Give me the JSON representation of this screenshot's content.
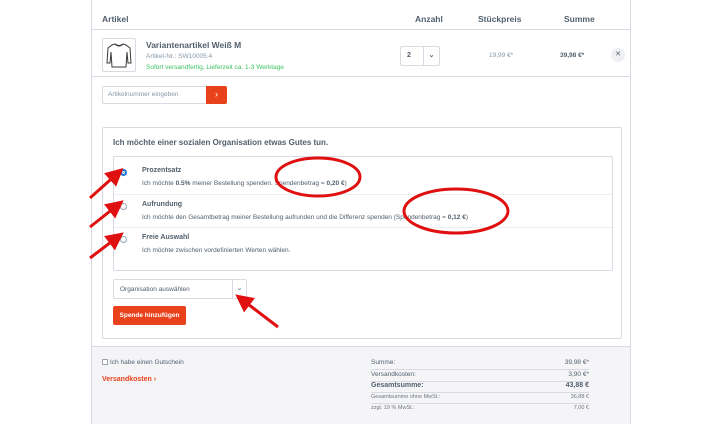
{
  "cart_header": {
    "article": "Artikel",
    "quantity": "Anzahl",
    "unit_price": "Stückpreis",
    "total": "Summe"
  },
  "item": {
    "name": "Variantenartikel Weiß M",
    "sku": "Artikel-Nr.: SW10005.4",
    "shipping": "Sofort versandfertig, Lieferzeit ca. 1-3 Werktage",
    "quantity": "2",
    "unit_price": "19,99 €*",
    "total": "39,98 €*",
    "remove_icon": "✕"
  },
  "article_input": {
    "placeholder": "Artikelnummer eingeben",
    "button": "›"
  },
  "donation": {
    "title": "Ich möchte einer sozialen Organisation etwas Gutes tun.",
    "options": [
      {
        "title": "Prozentsatz",
        "desc_pre": "Ich möchte ",
        "desc_bold": "0.5%",
        "desc_mid": " meiner Bestellung spenden. Spendenbetrag = ",
        "desc_amount": "0,20 €",
        "desc_post": ")",
        "selected": true
      },
      {
        "title": "Aufrundung",
        "desc_pre": "Ich möchte den Gesamtbetrag meiner Bestellung aufrunden und die Differenz spenden (Spendenbetrag = ",
        "desc_amount": "0,12 €",
        "desc_post": ")",
        "selected": false
      },
      {
        "title": "Freie Auswahl",
        "desc_pre": "Ich möchte zwischen vordefinierten Werten wählen.",
        "selected": false
      }
    ],
    "select_placeholder": "Organisation auswählen",
    "select_arrow": "⌄",
    "add_button": "Spende hinzufügen"
  },
  "footer": {
    "voucher": "Ich habe einen Gutschein",
    "shipping_link": "Versandkosten ›",
    "totals": [
      {
        "label": "Summe:",
        "value": "39,98 €*"
      },
      {
        "label": "Versandkosten:",
        "value": "3,90 €*"
      },
      {
        "label": "Gesamtsumme:",
        "value": "43,88 €"
      },
      {
        "label": "Gesamtsumme ohne MwSt.:",
        "value": "36,88 €"
      },
      {
        "label": "zzgl. 19 % MwSt.:",
        "value": "7,00 €"
      }
    ]
  },
  "colors": {
    "accent": "#e8411b",
    "annotation": "#e01010",
    "radio_selected": "#1b77d1",
    "in_stock": "#3cc261"
  }
}
